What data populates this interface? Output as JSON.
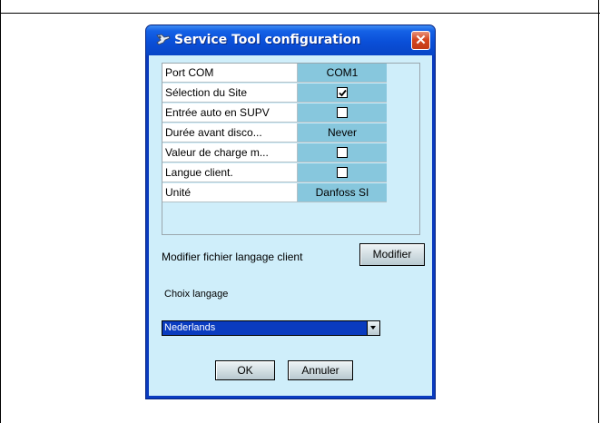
{
  "dialog": {
    "title": "Service Tool configuration",
    "close_label": "✕",
    "properties": [
      {
        "label": "Port COM",
        "type": "text",
        "value": "COM1"
      },
      {
        "label": "Sélection du Site",
        "type": "checkbox",
        "checked": true
      },
      {
        "label": "Entrée auto en SUPV",
        "type": "checkbox",
        "checked": false
      },
      {
        "label": "Durée avant disco...",
        "type": "text",
        "value": "Never"
      },
      {
        "label": "Valeur de charge m...",
        "type": "checkbox",
        "checked": false
      },
      {
        "label": "Langue client.",
        "type": "checkbox",
        "checked": false
      },
      {
        "label": "Unité",
        "type": "text",
        "value": "Danfoss SI"
      }
    ],
    "modify_file_label": "Modifier fichier langage client",
    "modify_button": "Modifier",
    "language_label": "Choix langage",
    "language_select": {
      "value": "Nederlands"
    },
    "ok_button": "OK",
    "cancel_button": "Annuler"
  },
  "colors": {
    "title_bar": "#0a4fd8",
    "content_bg": "#cfeefa",
    "value_cell_bg": "#87c7dd",
    "close_button": "#d5461f"
  },
  "icons": {
    "title": "service-tool-icon",
    "close": "close-icon",
    "dropdown": "chevron-down-icon",
    "checkbox_mark": "check-icon"
  }
}
